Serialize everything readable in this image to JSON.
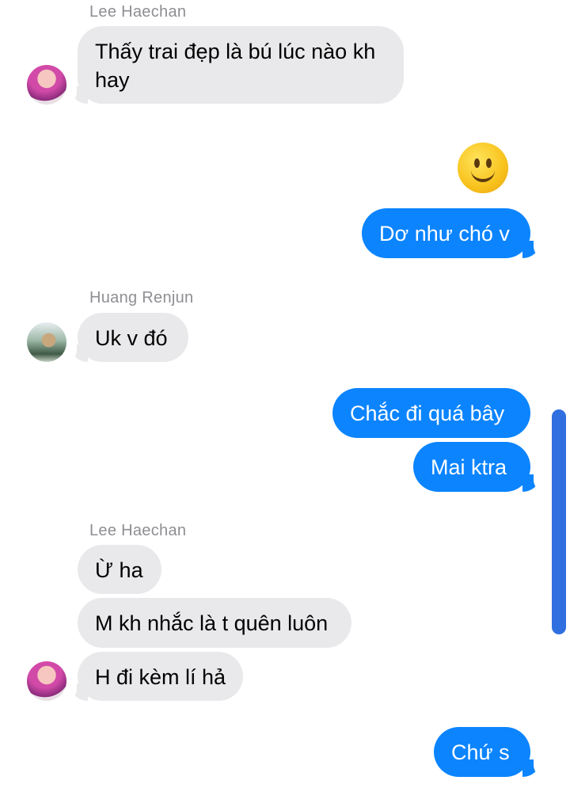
{
  "messages": {
    "g1": {
      "sender": "Lee Haechan",
      "bubbles": [
        "Thấy trai đẹp là bú lúc nào kh\nhay"
      ]
    },
    "me1": {
      "emoji": "slightly-smiling-face",
      "bubbles": [
        "Dơ như chó v"
      ]
    },
    "g2": {
      "sender": "Huang Renjun",
      "bubbles": [
        "Uk v đó"
      ]
    },
    "me2": {
      "bubbles": [
        "Chắc đi quá bây",
        "Mai ktra"
      ]
    },
    "g3": {
      "sender": "Lee Haechan",
      "bubbles": [
        "Ừ ha",
        "M kh nhắc là t quên luôn",
        "H đi kèm lí hả"
      ]
    },
    "me3": {
      "bubbles": [
        "Chứ s"
      ]
    }
  },
  "colors": {
    "incoming": "#e9e9eb",
    "outgoing": "#0b84fe",
    "sender_name": "#8e8e93",
    "scrollbar": "#2f6fe0"
  }
}
